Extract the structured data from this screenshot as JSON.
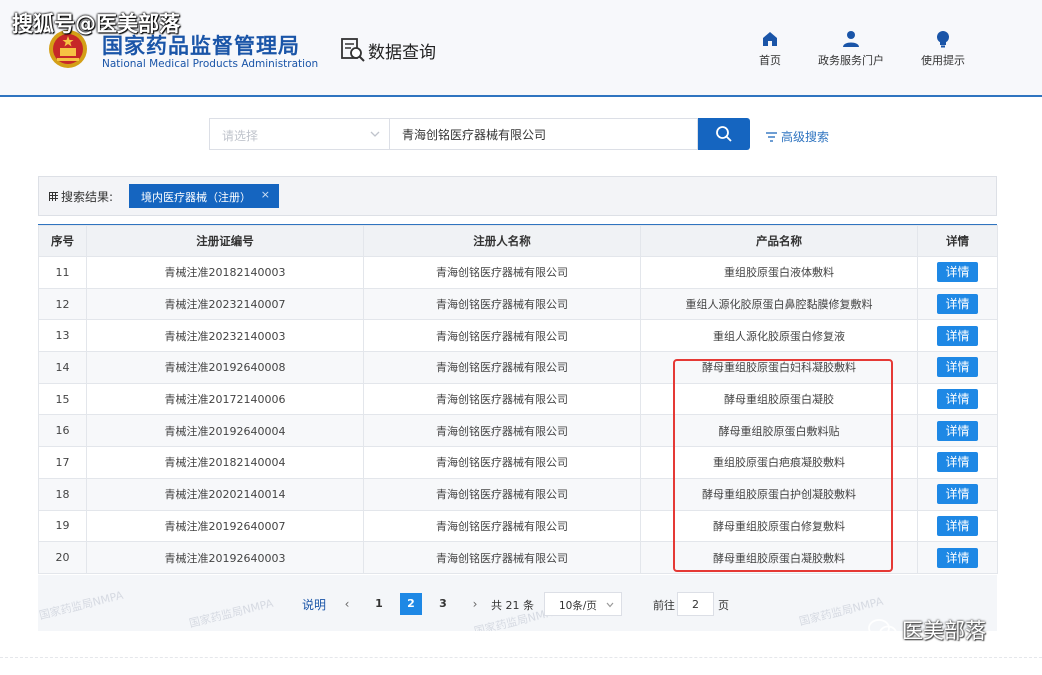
{
  "watermark_top": "搜狐号@医美部落",
  "header": {
    "org_cn": "国家药品监督管理局",
    "org_en": "National Medical Products Administration",
    "section_title": "数据查询",
    "nav": [
      {
        "label": "首页",
        "icon": "home-icon"
      },
      {
        "label": "政务服务门户",
        "icon": "user-icon"
      },
      {
        "label": "使用提示",
        "icon": "lightbulb-icon"
      }
    ]
  },
  "search": {
    "select_placeholder": "请选择",
    "query_value": "青海创铭医疗器械有限公司",
    "advanced_label": "高级搜索"
  },
  "results": {
    "label": "搜索结果:",
    "active_tag": "境内医疗器械（注册）",
    "tag_close": "×"
  },
  "table": {
    "headers": [
      "序号",
      "注册证编号",
      "注册人名称",
      "产品名称",
      "详情"
    ],
    "rows": [
      {
        "no": "11",
        "cert": "青械注准20182140003",
        "registrant": "青海创铭医疗器械有限公司",
        "product": "重组胶原蛋白液体敷料",
        "action": "详情"
      },
      {
        "no": "12",
        "cert": "青械注准20232140007",
        "registrant": "青海创铭医疗器械有限公司",
        "product": "重组人源化胶原蛋白鼻腔黏膜修复敷料",
        "action": "详情"
      },
      {
        "no": "13",
        "cert": "青械注准20232140003",
        "registrant": "青海创铭医疗器械有限公司",
        "product": "重组人源化胶原蛋白修复液",
        "action": "详情"
      },
      {
        "no": "14",
        "cert": "青械注准20192640008",
        "registrant": "青海创铭医疗器械有限公司",
        "product": "酵母重组胶原蛋白妇科凝胶敷料",
        "action": "详情"
      },
      {
        "no": "15",
        "cert": "青械注准20172140006",
        "registrant": "青海创铭医疗器械有限公司",
        "product": "酵母重组胶原蛋白凝胶",
        "action": "详情"
      },
      {
        "no": "16",
        "cert": "青械注准20192640004",
        "registrant": "青海创铭医疗器械有限公司",
        "product": "酵母重组胶原蛋白敷料贴",
        "action": "详情"
      },
      {
        "no": "17",
        "cert": "青械注准20182140004",
        "registrant": "青海创铭医疗器械有限公司",
        "product": "重组胶原蛋白疤痕凝胶敷料",
        "action": "详情"
      },
      {
        "no": "18",
        "cert": "青械注准20202140014",
        "registrant": "青海创铭医疗器械有限公司",
        "product": "酵母重组胶原蛋白护创凝胶敷料",
        "action": "详情"
      },
      {
        "no": "19",
        "cert": "青械注准20192640007",
        "registrant": "青海创铭医疗器械有限公司",
        "product": "酵母重组胶原蛋白修复敷料",
        "action": "详情"
      },
      {
        "no": "20",
        "cert": "青械注准20192640003",
        "registrant": "青海创铭医疗器械有限公司",
        "product": "酵母重组胶原蛋白凝胶敷料",
        "action": "详情"
      }
    ]
  },
  "pagination": {
    "note": "说明",
    "prev": "‹",
    "next": "›",
    "pages": [
      "1",
      "2",
      "3"
    ],
    "active_page": "2",
    "total": "共 21 条",
    "page_size": "10条/页",
    "goto_label": "前往",
    "goto_value": "2",
    "goto_suffix": "页",
    "faint_watermark": "国家药监局NMPA"
  },
  "watermark_bottom": "医美部落",
  "colors": {
    "brand_blue": "#1565c0",
    "detail_button": "#1e88e5",
    "highlight_box": "#e53935"
  }
}
